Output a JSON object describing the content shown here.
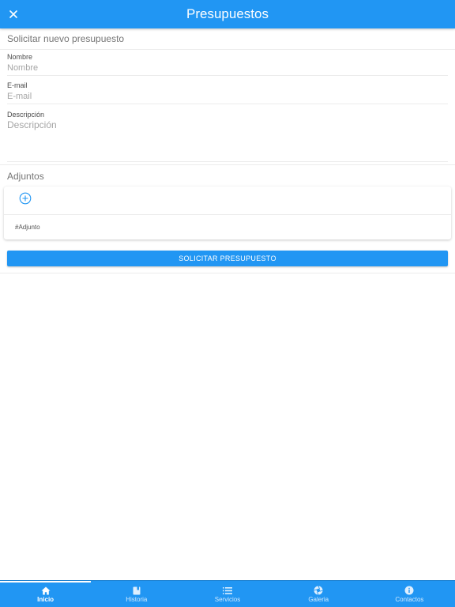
{
  "header": {
    "title": "Presupuestos",
    "close_icon": "close-icon"
  },
  "form": {
    "section_title": "Solicitar nuevo presupuesto",
    "name": {
      "label": "Nombre",
      "placeholder": "Nombre",
      "value": ""
    },
    "email": {
      "label": "E-mail",
      "placeholder": "E-mail",
      "value": ""
    },
    "description": {
      "label": "Descripción",
      "placeholder": "Descripción",
      "value": ""
    }
  },
  "attachments": {
    "section_title": "Adjuntos",
    "add_icon": "add-circle-icon",
    "item_label": "#Adjunto"
  },
  "submit_label": "SOLICITAR PRESUPUESTO",
  "tabs": [
    {
      "label": "Inicio",
      "icon": "home-icon",
      "active": true
    },
    {
      "label": "Historia",
      "icon": "book-icon",
      "active": false
    },
    {
      "label": "Servicios",
      "icon": "list-icon",
      "active": false
    },
    {
      "label": "Galeria",
      "icon": "aperture-icon",
      "active": false
    },
    {
      "label": "Contactos",
      "icon": "info-icon",
      "active": false
    }
  ],
  "colors": {
    "primary": "#2196f3",
    "text_muted": "#757575",
    "placeholder": "#a5a5a5"
  }
}
